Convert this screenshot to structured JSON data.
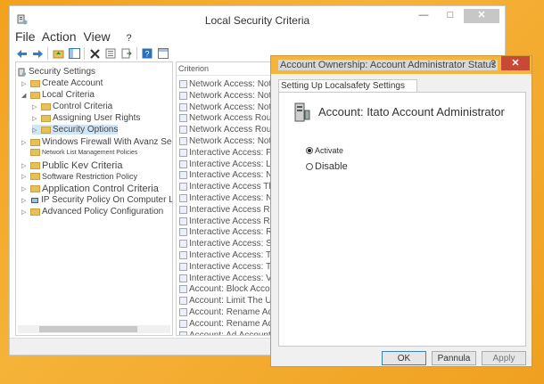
{
  "main_window": {
    "title": "Local Security Criteria",
    "minimize": "—",
    "maximize": "□",
    "close": "✕",
    "menu": {
      "file": "File",
      "action": "Action",
      "view": "View",
      "help": "?"
    }
  },
  "tree": {
    "items": [
      {
        "label": "Security Settings",
        "expander": ""
      },
      {
        "label": "Create Account",
        "expander": "▷"
      },
      {
        "label": "Local Criteria",
        "expander": "◢"
      },
      {
        "label": "Control Criteria",
        "expander": "▷"
      },
      {
        "label": "Assigning User Rights",
        "expander": "▷"
      },
      {
        "label": "Security Options",
        "expander": "▷"
      },
      {
        "label": "Windows Firewall With Avanz Security",
        "expander": "▷"
      },
      {
        "label": "Network List Management Policies",
        "expander": ""
      },
      {
        "label": "Public Kev Criteria",
        "expander": "▷"
      },
      {
        "label": "Software Restriction Policy",
        "expander": "▷"
      },
      {
        "label": "Application Control Criteria",
        "expander": "▷"
      },
      {
        "label": "IP Security Policy On Computer Loc",
        "expander": "▷"
      },
      {
        "label": "Advanced Policy Configuration",
        "expander": "▷"
      }
    ]
  },
  "list": {
    "header": "Criterion",
    "rows": [
      "Network Access: Not Conse",
      "Network Access: Not Conse",
      "Network Access: Not Conse",
      "Network Access Routes De",
      "Network Access Routes",
      "Network Access: Not Cons",
      "Interactive Access: Funzior",
      "Interactive Access: Limit",
      "Interactive Access: Not Ric",
      "Interactive Access There",
      "Interactive Access: Nurser",
      "Interactive Access Required",
      "Interactive Access Required",
      "Interactive Access: Requested",
      "Interactive Access: Soglia",
      "Interactive Access: Text D",
      "Interactive Access: Title C",
      "Interactive Access: Visuals",
      "Account: Block Accours",
      "Account: Limit The Use Of Ac",
      "Account: Rename Accoun",
      "Account: Rename Accoun",
      "Account: Ad Account Status"
    ]
  },
  "dialog": {
    "title": "Account Ownership: Account Administrator Status",
    "help": "?",
    "close": "✕",
    "tab": "Setting Up Localsafety Settings",
    "heading": "Account: Itato Account Administrator",
    "options": [
      "Activate",
      "Disable"
    ],
    "selected": "Activate",
    "buttons": {
      "ok": "OK",
      "cancel": "Pannula",
      "apply": "Apply"
    }
  }
}
